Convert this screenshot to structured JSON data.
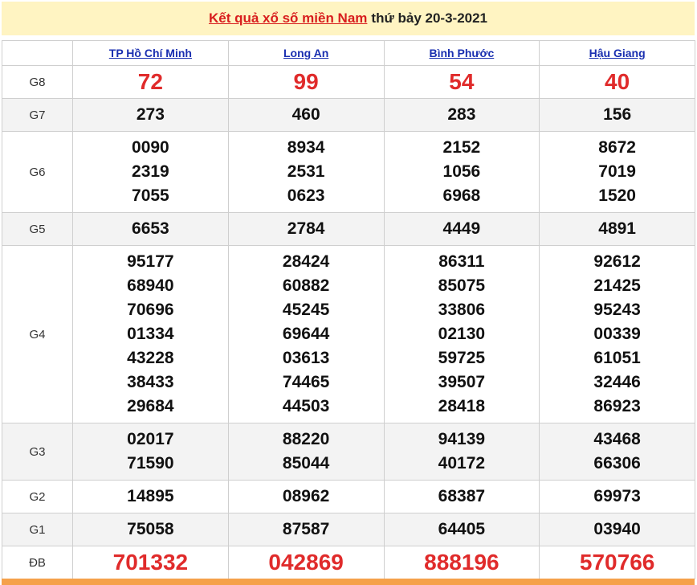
{
  "header": {
    "title_link": "Kết quả xổ số miền Nam",
    "title_rest": "thứ bảy 20-3-2021"
  },
  "provinces": [
    "TP Hồ Chí Minh",
    "Long An",
    "Bình Phước",
    "Hậu Giang"
  ],
  "prizes": [
    {
      "label": "G8",
      "results": [
        [
          "72"
        ],
        [
          "99"
        ],
        [
          "54"
        ],
        [
          "40"
        ]
      ]
    },
    {
      "label": "G7",
      "results": [
        [
          "273"
        ],
        [
          "460"
        ],
        [
          "283"
        ],
        [
          "156"
        ]
      ]
    },
    {
      "label": "G6",
      "results": [
        [
          "0090",
          "2319",
          "7055"
        ],
        [
          "8934",
          "2531",
          "0623"
        ],
        [
          "2152",
          "1056",
          "6968"
        ],
        [
          "8672",
          "7019",
          "1520"
        ]
      ]
    },
    {
      "label": "G5",
      "results": [
        [
          "6653"
        ],
        [
          "2784"
        ],
        [
          "4449"
        ],
        [
          "4891"
        ]
      ]
    },
    {
      "label": "G4",
      "results": [
        [
          "95177",
          "68940",
          "70696",
          "01334",
          "43228",
          "38433",
          "29684"
        ],
        [
          "28424",
          "60882",
          "45245",
          "69644",
          "03613",
          "74465",
          "44503"
        ],
        [
          "86311",
          "85075",
          "33806",
          "02130",
          "59725",
          "39507",
          "28418"
        ],
        [
          "92612",
          "21425",
          "95243",
          "00339",
          "61051",
          "32446",
          "86923"
        ]
      ]
    },
    {
      "label": "G3",
      "results": [
        [
          "02017",
          "71590"
        ],
        [
          "88220",
          "85044"
        ],
        [
          "94139",
          "40172"
        ],
        [
          "43468",
          "66306"
        ]
      ]
    },
    {
      "label": "G2",
      "results": [
        [
          "14895"
        ],
        [
          "08962"
        ],
        [
          "68387"
        ],
        [
          "69973"
        ]
      ]
    },
    {
      "label": "G1",
      "results": [
        [
          "75058"
        ],
        [
          "87587"
        ],
        [
          "64405"
        ],
        [
          "03940"
        ]
      ]
    },
    {
      "label": "ĐB",
      "results": [
        [
          "701332"
        ],
        [
          "042869"
        ],
        [
          "888196"
        ],
        [
          "570766"
        ]
      ]
    }
  ],
  "colors": {
    "title_bg": "#fff4c2",
    "title_link": "#d81e1e",
    "highlight_red": "#e02b2b",
    "province_link": "#1a2fb0",
    "bottom_strip": "#f5a14a"
  }
}
